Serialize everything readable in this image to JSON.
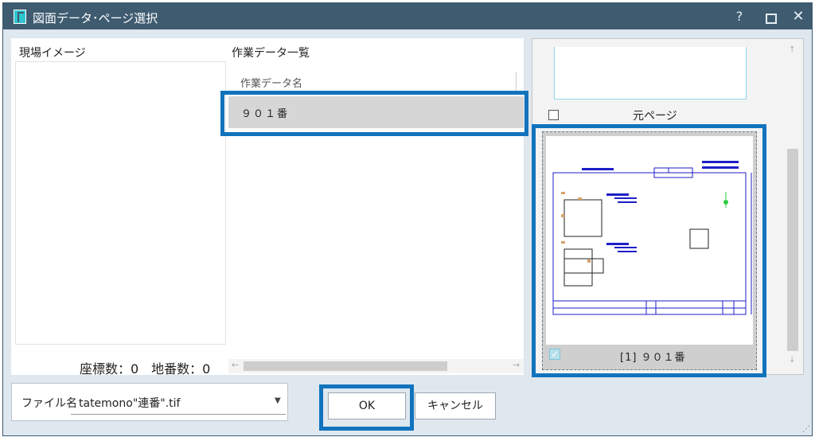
{
  "window": {
    "title": "図面データ･ページ選択",
    "help_icon": "?",
    "close_icon": "✕"
  },
  "left": {
    "site_image_label": "現場イメージ",
    "counts_text": "座標数：0　地番数：0"
  },
  "work": {
    "label": "作業データ一覧",
    "column_header": "作業データ名",
    "rows": [
      {
        "name": "９０１番"
      }
    ]
  },
  "preview": {
    "orig_page_label": "元ページ",
    "page_label": "[1] ９０１番"
  },
  "file": {
    "label": "ファイル名",
    "value": "tatemono\"連番\".tif"
  },
  "buttons": {
    "ok": "OK",
    "cancel": "キャンセル"
  },
  "colors": {
    "titlebar": "#3e5b70",
    "highlight": "#1273bd",
    "drawing_lines": "#1e1ec8"
  }
}
